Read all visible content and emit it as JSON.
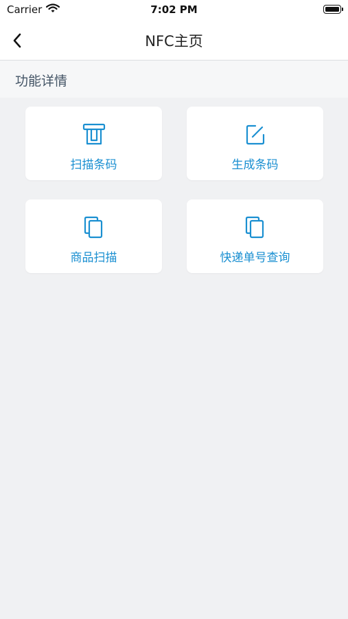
{
  "status_bar": {
    "carrier": "Carrier",
    "time": "7:02 PM"
  },
  "nav": {
    "title": "NFC主页",
    "back_icon": "chevron-left-icon"
  },
  "section": {
    "title": "功能详情"
  },
  "accent_color": "#1a8fd1",
  "cards": [
    {
      "label": "扫描条码",
      "icon": "card-reader-icon"
    },
    {
      "label": "生成条码",
      "icon": "edit-icon"
    },
    {
      "label": "商品扫描",
      "icon": "copy-icon"
    },
    {
      "label": "快递单号查询",
      "icon": "copy-icon"
    }
  ]
}
